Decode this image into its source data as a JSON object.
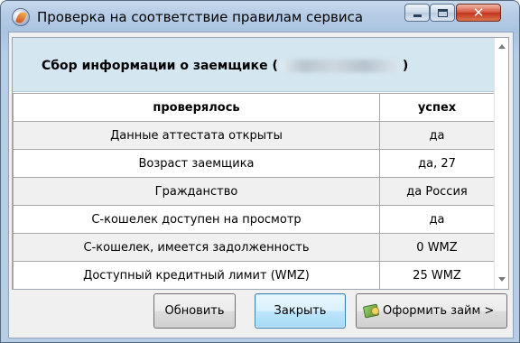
{
  "window": {
    "title": "Проверка на соответствие правилам сервиса"
  },
  "header": {
    "prefix": "Сбор информации о заемщике (",
    "suffix": ")"
  },
  "table": {
    "columns": [
      "проверялось",
      "успех"
    ],
    "rows": [
      {
        "check": "Данные аттестата открыты",
        "result": "да"
      },
      {
        "check": "Возраст заемщика",
        "result": "да, 27"
      },
      {
        "check": "Гражданство",
        "result": "да Россия"
      },
      {
        "check": "С-кошелек доступен на просмотр",
        "result": "да"
      },
      {
        "check": "С-кошелек, имеется задолженность",
        "result": "0 WMZ"
      },
      {
        "check": "Доступный кредитный лимит (WMZ)",
        "result": "25 WMZ"
      }
    ]
  },
  "buttons": {
    "refresh": "Обновить",
    "close": "Закрыть",
    "loan": "Оформить займ",
    "loan_arrow": ">"
  },
  "icons": {
    "app": "webmoney-app-icon",
    "minimize": "minimize-icon",
    "maximize": "maximize-icon",
    "close": "close-icon",
    "loan": "money-icon"
  },
  "colors": {
    "header_band": "#d4e6f0",
    "close_button": "#c2321c",
    "default_button": "#bee6fd"
  }
}
